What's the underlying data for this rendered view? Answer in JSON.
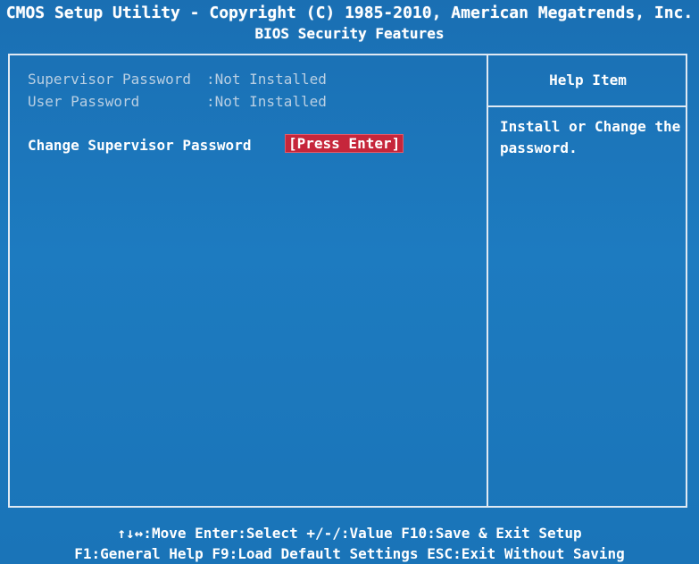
{
  "header": {
    "title": "CMOS Setup Utility - Copyright (C) 1985-2010, American Megatrends, Inc.",
    "subtitle": "BIOS Security Features"
  },
  "settings": {
    "supervisor_password_label": "Supervisor Password",
    "supervisor_password_value": ":Not Installed",
    "user_password_label": "User Password",
    "user_password_value": ":Not Installed",
    "change_supervisor_label": "Change Supervisor Password",
    "change_supervisor_action": "[Press Enter]"
  },
  "help": {
    "title": "Help Item",
    "text": "Install or Change the password."
  },
  "footer": {
    "line1": "↑↓↔:Move  Enter:Select  +/-/:Value  F10:Save & Exit Setup",
    "line2": "F1:General Help  F9:Load Default Settings  ESC:Exit Without Saving"
  },
  "colors": {
    "background": "#1b73ba",
    "highlight": "#c6263b",
    "frame": "#dfe9f3",
    "dim_text": "#b9cfe3"
  }
}
